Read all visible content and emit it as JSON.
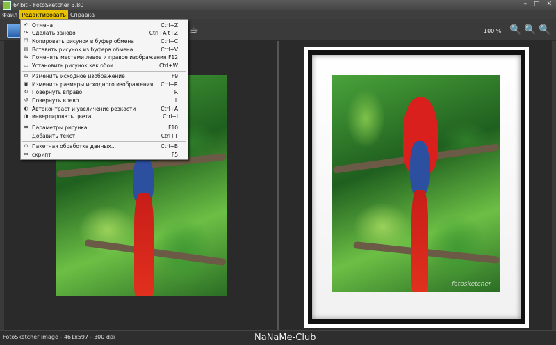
{
  "window": {
    "title": "64bit - FotoSketcher 3.80",
    "min": "–",
    "max": "□",
    "close": "✕"
  },
  "menu": {
    "items": [
      "Файл",
      "Редактировать",
      "Справка"
    ]
  },
  "toolbar": {
    "zoom": "100 %"
  },
  "dropdown": {
    "items": [
      {
        "icon": "undo-icon",
        "glyph": "↶",
        "label": "Отмена",
        "shortcut": "Ctrl+Z"
      },
      {
        "icon": "redo-icon",
        "glyph": "↷",
        "label": "Сделать заново",
        "shortcut": "Ctrl+Alt+Z"
      },
      {
        "icon": "copy-icon",
        "glyph": "❐",
        "label": "Копировать рисунок в буфер обмена",
        "shortcut": "Ctrl+C"
      },
      {
        "icon": "paste-icon",
        "glyph": "▤",
        "label": "Вставить рисунок из буфера обмена",
        "shortcut": "Ctrl+V"
      },
      {
        "icon": "swap-icon",
        "glyph": "⇆",
        "label": "Поменять местами левое и правое изображения",
        "shortcut": "F12"
      },
      {
        "icon": "monitor-icon",
        "glyph": "▭",
        "label": "Установить рисунок как обои",
        "shortcut": "Ctrl+W"
      },
      {
        "icon": "gear-icon",
        "glyph": "⚙",
        "label": "Изменить исходное изображение",
        "shortcut": "F9"
      },
      {
        "icon": "resize-icon",
        "glyph": "▣",
        "label": "Изменить размеры исходного изображения...",
        "shortcut": "Ctrl+R"
      },
      {
        "icon": "rotate-right-icon",
        "glyph": "↻",
        "label": "Повернуть вправо",
        "shortcut": "R"
      },
      {
        "icon": "rotate-left-icon",
        "glyph": "↺",
        "label": "Повернуть влево",
        "shortcut": "L"
      },
      {
        "icon": "contrast-icon",
        "glyph": "◐",
        "label": "Автоконтраст и увеличение резкости",
        "shortcut": "Ctrl+A"
      },
      {
        "icon": "invert-icon",
        "glyph": "◑",
        "label": "инвертировать цвета",
        "shortcut": "Ctrl+I"
      },
      {
        "icon": "palette-icon",
        "glyph": "✱",
        "label": "Параметры рисунка...",
        "shortcut": "F10"
      },
      {
        "icon": "text-icon",
        "glyph": "T",
        "label": "Добавить текст",
        "shortcut": "Ctrl+T"
      },
      {
        "icon": "batch-icon",
        "glyph": "⊙",
        "label": "Пакетная обработка данных...",
        "shortcut": "Ctrl+B"
      },
      {
        "icon": "script-icon",
        "glyph": "✲",
        "label": "скрипт",
        "shortcut": "F5"
      }
    ]
  },
  "image": {
    "watermark": "fotosketcher"
  },
  "status": {
    "info": "FotoSketcher image - 461x597 - 300 dpi",
    "brand": "NaNaMe-Club"
  }
}
